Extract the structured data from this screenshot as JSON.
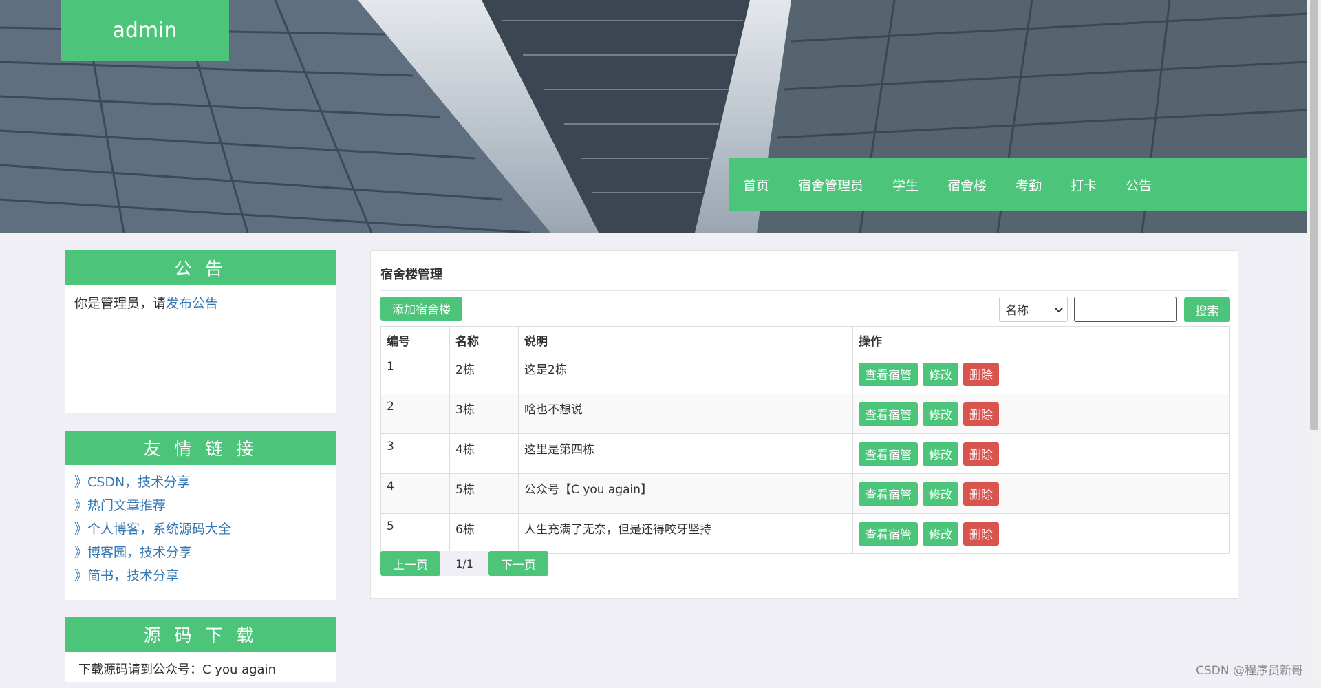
{
  "brand": "admin",
  "nav": [
    "首页",
    "宿舍管理员",
    "学生",
    "宿舍楼",
    "考勤",
    "打卡",
    "公告"
  ],
  "notice": {
    "title": "公 告",
    "text": "你是管理员，请",
    "link": "发布公告"
  },
  "friends": {
    "title": "友 情 链 接",
    "items": [
      "》CSDN，技术分享",
      "》热门文章推荐",
      "》个人博客，系统源码大全",
      "》博客园，技术分享",
      "》简书，技术分享"
    ]
  },
  "download": {
    "title": "源 码 下 载",
    "text": "下载源码请到公众号：C you again"
  },
  "main": {
    "title": "宿舍楼管理",
    "add_label": "添加宿舍楼",
    "search_select": "名称",
    "search_input": "",
    "search_label": "搜索",
    "columns": [
      "编号",
      "名称",
      "说明",
      "操作"
    ],
    "rows": [
      {
        "id": "1",
        "name": "2栋",
        "desc": "这是2栋"
      },
      {
        "id": "2",
        "name": "3栋",
        "desc": "啥也不想说"
      },
      {
        "id": "3",
        "name": "4栋",
        "desc": "这里是第四栋"
      },
      {
        "id": "4",
        "name": "5栋",
        "desc": "公众号【C you again】"
      },
      {
        "id": "5",
        "name": "6栋",
        "desc": "人生充满了无奈，但是还得咬牙坚持"
      }
    ],
    "actions": {
      "view": "查看宿管",
      "edit": "修改",
      "delete": "删除"
    }
  },
  "pager": {
    "prev": "上一页",
    "page": "1/1",
    "next": "下一页"
  },
  "watermark": "CSDN @程序员新哥",
  "colors": {
    "accent": "#4cc47a",
    "danger": "#d9534f",
    "link": "#3378b5",
    "background": "#efeff5"
  }
}
